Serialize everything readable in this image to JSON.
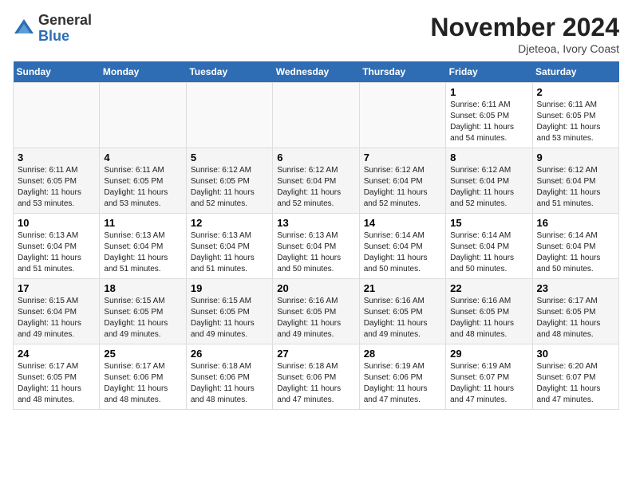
{
  "logo": {
    "general": "General",
    "blue": "Blue"
  },
  "title": "November 2024",
  "location": "Djeteoa, Ivory Coast",
  "days_header": [
    "Sunday",
    "Monday",
    "Tuesday",
    "Wednesday",
    "Thursday",
    "Friday",
    "Saturday"
  ],
  "weeks": [
    [
      {
        "day": "",
        "info": ""
      },
      {
        "day": "",
        "info": ""
      },
      {
        "day": "",
        "info": ""
      },
      {
        "day": "",
        "info": ""
      },
      {
        "day": "",
        "info": ""
      },
      {
        "day": "1",
        "info": "Sunrise: 6:11 AM\nSunset: 6:05 PM\nDaylight: 11 hours and 54 minutes."
      },
      {
        "day": "2",
        "info": "Sunrise: 6:11 AM\nSunset: 6:05 PM\nDaylight: 11 hours and 53 minutes."
      }
    ],
    [
      {
        "day": "3",
        "info": "Sunrise: 6:11 AM\nSunset: 6:05 PM\nDaylight: 11 hours and 53 minutes."
      },
      {
        "day": "4",
        "info": "Sunrise: 6:11 AM\nSunset: 6:05 PM\nDaylight: 11 hours and 53 minutes."
      },
      {
        "day": "5",
        "info": "Sunrise: 6:12 AM\nSunset: 6:05 PM\nDaylight: 11 hours and 52 minutes."
      },
      {
        "day": "6",
        "info": "Sunrise: 6:12 AM\nSunset: 6:04 PM\nDaylight: 11 hours and 52 minutes."
      },
      {
        "day": "7",
        "info": "Sunrise: 6:12 AM\nSunset: 6:04 PM\nDaylight: 11 hours and 52 minutes."
      },
      {
        "day": "8",
        "info": "Sunrise: 6:12 AM\nSunset: 6:04 PM\nDaylight: 11 hours and 52 minutes."
      },
      {
        "day": "9",
        "info": "Sunrise: 6:12 AM\nSunset: 6:04 PM\nDaylight: 11 hours and 51 minutes."
      }
    ],
    [
      {
        "day": "10",
        "info": "Sunrise: 6:13 AM\nSunset: 6:04 PM\nDaylight: 11 hours and 51 minutes."
      },
      {
        "day": "11",
        "info": "Sunrise: 6:13 AM\nSunset: 6:04 PM\nDaylight: 11 hours and 51 minutes."
      },
      {
        "day": "12",
        "info": "Sunrise: 6:13 AM\nSunset: 6:04 PM\nDaylight: 11 hours and 51 minutes."
      },
      {
        "day": "13",
        "info": "Sunrise: 6:13 AM\nSunset: 6:04 PM\nDaylight: 11 hours and 50 minutes."
      },
      {
        "day": "14",
        "info": "Sunrise: 6:14 AM\nSunset: 6:04 PM\nDaylight: 11 hours and 50 minutes."
      },
      {
        "day": "15",
        "info": "Sunrise: 6:14 AM\nSunset: 6:04 PM\nDaylight: 11 hours and 50 minutes."
      },
      {
        "day": "16",
        "info": "Sunrise: 6:14 AM\nSunset: 6:04 PM\nDaylight: 11 hours and 50 minutes."
      }
    ],
    [
      {
        "day": "17",
        "info": "Sunrise: 6:15 AM\nSunset: 6:04 PM\nDaylight: 11 hours and 49 minutes."
      },
      {
        "day": "18",
        "info": "Sunrise: 6:15 AM\nSunset: 6:05 PM\nDaylight: 11 hours and 49 minutes."
      },
      {
        "day": "19",
        "info": "Sunrise: 6:15 AM\nSunset: 6:05 PM\nDaylight: 11 hours and 49 minutes."
      },
      {
        "day": "20",
        "info": "Sunrise: 6:16 AM\nSunset: 6:05 PM\nDaylight: 11 hours and 49 minutes."
      },
      {
        "day": "21",
        "info": "Sunrise: 6:16 AM\nSunset: 6:05 PM\nDaylight: 11 hours and 49 minutes."
      },
      {
        "day": "22",
        "info": "Sunrise: 6:16 AM\nSunset: 6:05 PM\nDaylight: 11 hours and 48 minutes."
      },
      {
        "day": "23",
        "info": "Sunrise: 6:17 AM\nSunset: 6:05 PM\nDaylight: 11 hours and 48 minutes."
      }
    ],
    [
      {
        "day": "24",
        "info": "Sunrise: 6:17 AM\nSunset: 6:05 PM\nDaylight: 11 hours and 48 minutes."
      },
      {
        "day": "25",
        "info": "Sunrise: 6:17 AM\nSunset: 6:06 PM\nDaylight: 11 hours and 48 minutes."
      },
      {
        "day": "26",
        "info": "Sunrise: 6:18 AM\nSunset: 6:06 PM\nDaylight: 11 hours and 48 minutes."
      },
      {
        "day": "27",
        "info": "Sunrise: 6:18 AM\nSunset: 6:06 PM\nDaylight: 11 hours and 47 minutes."
      },
      {
        "day": "28",
        "info": "Sunrise: 6:19 AM\nSunset: 6:06 PM\nDaylight: 11 hours and 47 minutes."
      },
      {
        "day": "29",
        "info": "Sunrise: 6:19 AM\nSunset: 6:07 PM\nDaylight: 11 hours and 47 minutes."
      },
      {
        "day": "30",
        "info": "Sunrise: 6:20 AM\nSunset: 6:07 PM\nDaylight: 11 hours and 47 minutes."
      }
    ]
  ]
}
